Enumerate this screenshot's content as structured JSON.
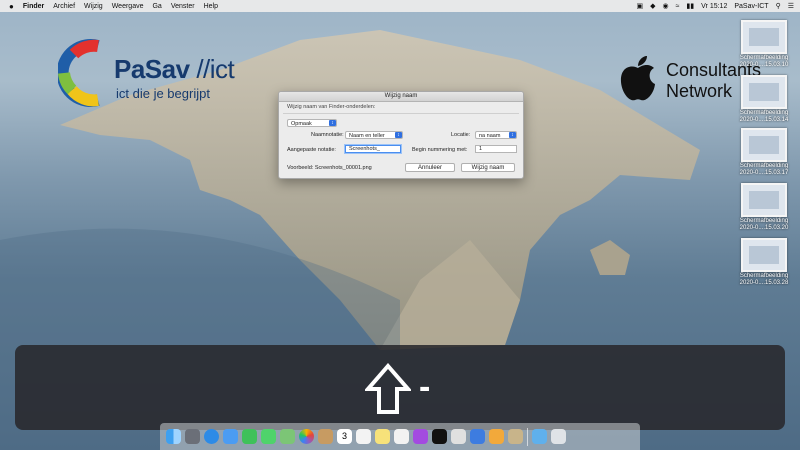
{
  "menubar": {
    "apple": "",
    "items": [
      "Finder",
      "Archief",
      "Wijzig",
      "Weergave",
      "Ga",
      "Venster",
      "Help"
    ],
    "clock": "Vr 15:12",
    "user": "PaSav-ICT"
  },
  "logos": {
    "pasav_name": "PaSav",
    "pasav_suffix": "//ict",
    "pasav_tagline": "ict die je begrijpt",
    "acn_line1": "Consultants",
    "acn_line2": "Network"
  },
  "desktop_icons": [
    {
      "line1": "Schermafbeelding",
      "line2": "2020-0....15.03.10"
    },
    {
      "line1": "Schermafbeelding",
      "line2": "2020-0....15.03.14"
    },
    {
      "line1": "Schermafbeelding",
      "line2": "2020-0....15.03.17"
    },
    {
      "line1": "Schermafbeelding",
      "line2": "2020-0....15.03.20"
    },
    {
      "line1": "Schermafbeelding",
      "line2": "2020-0....15.03.28"
    }
  ],
  "dialog": {
    "title": "Wijzig naam",
    "subtitle": "Wijzig naam van Finder-onderdelen:",
    "format_popup": "Opmaak",
    "name_format_label": "Naamnotatie:",
    "name_format_value": "Naam en teller",
    "location_label": "Locatie:",
    "location_value": "na naam",
    "custom_format_label": "Aangepaste notatie:",
    "custom_format_value": "Screenhots_",
    "start_number_label": "Begin nummering met:",
    "start_number_value": "1",
    "example": "Voorbeeld: Screenhots_00001.png",
    "cancel": "Annuleer",
    "confirm": "Wijzig naam"
  },
  "overlay": {
    "symbol": "-"
  },
  "dock": {
    "calendar_day": "3"
  }
}
